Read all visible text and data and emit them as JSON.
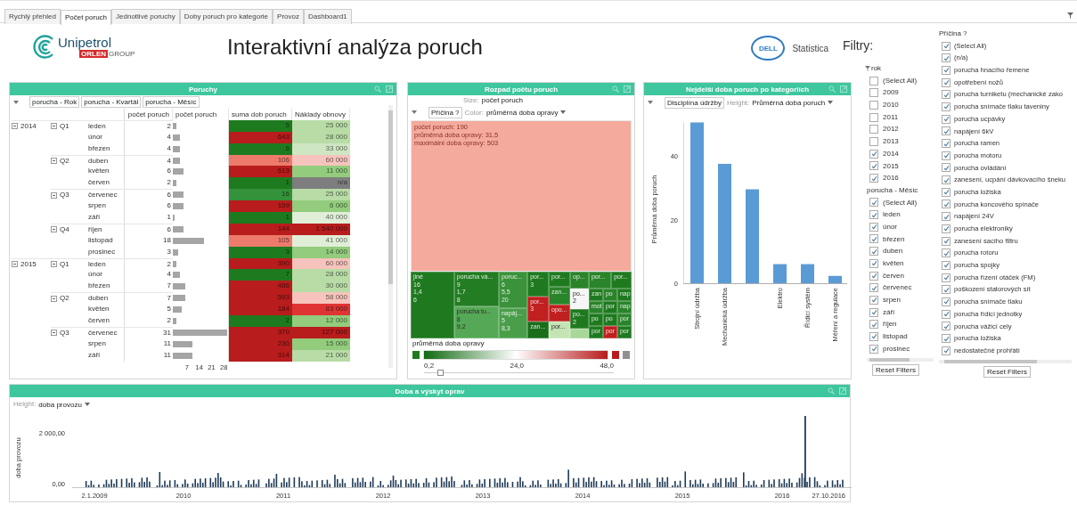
{
  "tabs": [
    {
      "label": "Rychlý přehled",
      "selected": false
    },
    {
      "label": "Počet poruch",
      "selected": true
    },
    {
      "label": "Jednotlivé poruchy",
      "selected": false
    },
    {
      "label": "Doby poruch pro kategorie",
      "selected": false
    },
    {
      "label": "Provoz",
      "selected": false
    },
    {
      "label": "Dashboard1",
      "selected": false
    }
  ],
  "header": {
    "logo_name": "Unipetrol",
    "logo_tag": "ORLEN",
    "logo_group": "GROUP",
    "title": "Interaktivní analýza poruch",
    "vendor_mark": "DELL",
    "vendor_product": "Statistica",
    "filters_title": "Filtry:"
  },
  "poruchy": {
    "title": "Poruchy",
    "fields": [
      "porucha - Rok",
      "porucha - Kvartál",
      "porucha - Měsíc"
    ],
    "columns": [
      "počet poruch",
      "počet poruch",
      "suma dob poruch",
      "Náklady obnovy"
    ],
    "bar_ticks": [
      "7",
      "14",
      "21",
      "28"
    ],
    "years": [
      {
        "label": "2014",
        "expanded": true,
        "children": [
          {
            "label": "Q1",
            "expanded": true,
            "children": [
              {
                "month": "leden",
                "count": "2",
                "suma": {
                  "text": "5",
                  "color": "#1e7a1e"
                },
                "naklady": {
                  "text": "25 000",
                  "color": "#b8dca6"
                }
              },
              {
                "month": "únor",
                "count": "4",
                "suma": {
                  "text": "643",
                  "color": "#b81c1c"
                },
                "naklady": {
                  "text": "28 000",
                  "color": "#b8dca6"
                }
              },
              {
                "month": "březen",
                "count": "4",
                "suma": {
                  "text": "6",
                  "color": "#1e7a1e"
                },
                "naklady": {
                  "text": "33 000",
                  "color": "#cfe6c2"
                }
              }
            ]
          },
          {
            "label": "Q2",
            "expanded": true,
            "children": [
              {
                "month": "duben",
                "count": "4",
                "suma": {
                  "text": "106",
                  "color": "#ee7a6c"
                },
                "naklady": {
                  "text": "60 000",
                  "color": "#f6c4bc"
                }
              },
              {
                "month": "květen",
                "count": "6",
                "suma": {
                  "text": "613",
                  "color": "#b81c1c"
                },
                "naklady": {
                  "text": "11 000",
                  "color": "#92cc7c"
                }
              },
              {
                "month": "červen",
                "count": "2",
                "suma": {
                  "text": "1",
                  "color": "#1e7a1e"
                },
                "naklady": {
                  "text": "n/a",
                  "color": "#7e7e7e"
                }
              }
            ]
          },
          {
            "label": "Q3",
            "expanded": true,
            "children": [
              {
                "month": "červenec",
                "count": "6",
                "suma": {
                  "text": "16",
                  "color": "#34923a"
                },
                "naklady": {
                  "text": "25 000",
                  "color": "#b8dca6"
                }
              },
              {
                "month": "srpen",
                "count": "6",
                "suma": {
                  "text": "159",
                  "color": "#b81c1c"
                },
                "naklady": {
                  "text": "6 000",
                  "color": "#92cc7c"
                }
              },
              {
                "month": "září",
                "count": "1",
                "suma": {
                  "text": "1",
                  "color": "#1e7a1e"
                },
                "naklady": {
                  "text": "40 000",
                  "color": "#e0eed8"
                }
              }
            ]
          },
          {
            "label": "Q4",
            "expanded": true,
            "children": [
              {
                "month": "říjen",
                "count": "6",
                "suma": {
                  "text": "144",
                  "color": "#b81c1c"
                },
                "naklady": {
                  "text": "1 540 000",
                  "color": "#b81c1c"
                }
              },
              {
                "month": "listopad",
                "count": "18",
                "suma": {
                  "text": "105",
                  "color": "#ee7a6c"
                },
                "naklady": {
                  "text": "41 000",
                  "color": "#e0eed8"
                }
              },
              {
                "month": "prosinec",
                "count": "3",
                "suma": {
                  "text": "3",
                  "color": "#1e7a1e"
                },
                "naklady": {
                  "text": "14 000",
                  "color": "#92cc7c"
                }
              }
            ]
          }
        ]
      },
      {
        "label": "2015",
        "expanded": true,
        "children": [
          {
            "label": "Q1",
            "expanded": true,
            "children": [
              {
                "month": "leden",
                "count": "2",
                "suma": {
                  "text": "390",
                  "color": "#b81c1c"
                },
                "naklady": {
                  "text": "60 000",
                  "color": "#f6c4bc"
                }
              },
              {
                "month": "únor",
                "count": "4",
                "suma": {
                  "text": "7",
                  "color": "#1e7a1e"
                },
                "naklady": {
                  "text": "28 000",
                  "color": "#b8dca6"
                }
              },
              {
                "month": "březen",
                "count": "7",
                "suma": {
                  "text": "486",
                  "color": "#b81c1c"
                },
                "naklady": {
                  "text": "30 000",
                  "color": "#b8dca6"
                }
              }
            ]
          },
          {
            "label": "Q2",
            "expanded": true,
            "children": [
              {
                "month": "duben",
                "count": "7",
                "suma": {
                  "text": "593",
                  "color": "#b81c1c"
                },
                "naklady": {
                  "text": "58 000",
                  "color": "#f6c4bc"
                }
              },
              {
                "month": "květen",
                "count": "5",
                "suma": {
                  "text": "184",
                  "color": "#b81c1c"
                },
                "naklady": {
                  "text": "83 000",
                  "color": "#e03434"
                }
              },
              {
                "month": "červen",
                "count": "2",
                "suma": {
                  "text": "2",
                  "color": "#1e7a1e"
                },
                "naklady": {
                  "text": "12 000",
                  "color": "#92cc7c"
                }
              }
            ]
          },
          {
            "label": "Q3",
            "expanded": true,
            "children": [
              {
                "month": "červenec",
                "count": "31",
                "suma": {
                  "text": "370",
                  "color": "#b81c1c"
                },
                "naklady": {
                  "text": "127 000",
                  "color": "#b81c1c"
                }
              },
              {
                "month": "srpen",
                "count": "11",
                "suma": {
                  "text": "230",
                  "color": "#b81c1c"
                },
                "naklady": {
                  "text": "15 000",
                  "color": "#92cc7c"
                }
              },
              {
                "month": "září",
                "count": "11",
                "suma": {
                  "text": "314",
                  "color": "#b81c1c"
                },
                "naklady": {
                  "text": "21 000",
                  "color": "#b8dca6"
                }
              }
            ]
          }
        ]
      }
    ]
  },
  "treemap": {
    "title": "Rozpad počtu poruch",
    "size_label": "Size:",
    "size_value": "počet poruch",
    "field": "Příčina ?",
    "color_label": "Color:",
    "color_value": "průměrná doba opravy",
    "main_tile": {
      "color": "#f4aa9c",
      "lines": [
        "počet poruch: 190",
        "průměrná doba opravy: 31,5",
        "maximální doba opravy: 503"
      ]
    },
    "tiles": [
      {
        "color": "#1f7a1f",
        "lines": [
          "jiné",
          "16",
          "1,4",
          "6"
        ]
      },
      {
        "color": "#237d23",
        "lines": [
          "porucha vá...",
          "9",
          "1,7",
          "8"
        ]
      },
      {
        "color": "#55a855",
        "lines": [
          "porucha tu...",
          "8",
          "9,2"
        ]
      },
      {
        "color": "#3a923a",
        "lines": [
          "poruc...",
          "6",
          "5,5",
          "20"
        ]
      },
      {
        "color": "#4a9e4a",
        "lines": [
          "napáj...",
          "5",
          "8,3"
        ]
      },
      {
        "color": "#1f7a1f",
        "lines": [
          "por...",
          "3"
        ]
      },
      {
        "color": "#c02020",
        "lines": [
          "por...",
          "3"
        ]
      },
      {
        "color": "#1a6e1a",
        "lines": [
          "zan..."
        ]
      },
      {
        "color": "#1f7a1f",
        "lines": [
          "por..."
        ]
      },
      {
        "color": "#2a842a",
        "lines": [
          "zan..."
        ]
      },
      {
        "color": "#c02020",
        "lines": [
          "opo..."
        ]
      },
      {
        "color": "#c4e4b4",
        "lines": [
          "por..."
        ]
      },
      {
        "color": "#2a842a",
        "lines": [
          "op..."
        ]
      },
      {
        "color": "#f6f6f6",
        "lines": [
          "po...",
          "2"
        ]
      },
      {
        "color": "#1f7a1f",
        "lines": [
          "po...",
          "2"
        ]
      },
      {
        "color": "#a8d898"
      },
      {
        "color": "#2a842a",
        "lines": [
          "por..."
        ]
      },
      {
        "color": "#1f7a1f",
        "lines": [
          "por..."
        ]
      },
      {
        "color": "#1f7a1f",
        "lines": [
          "zan"
        ]
      },
      {
        "color": "#2a842a",
        "lines": [
          "po"
        ]
      },
      {
        "color": "#1f7a1f",
        "lines": [
          "nap"
        ]
      },
      {
        "color": "#2a842a",
        "lines": [
          "mot"
        ]
      },
      {
        "color": "#1f7a1f",
        "lines": [
          "por"
        ]
      },
      {
        "color": "#2a842a",
        "lines": [
          "nap"
        ]
      },
      {
        "color": "#1f7a1f",
        "lines": [
          "po"
        ]
      },
      {
        "color": "#1f7a1f",
        "lines": [
          "po"
        ]
      },
      {
        "color": "#2a842a",
        "lines": [
          "por"
        ]
      },
      {
        "color": "#1f7a1f",
        "lines": [
          "por"
        ]
      },
      {
        "color": "#c02020",
        "lines": [
          "por"
        ]
      },
      {
        "color": "#1f7a1f",
        "lines": [
          "por"
        ]
      }
    ],
    "legend": {
      "title": "průměrná doba opravy",
      "labels": [
        "0,2",
        "24,0",
        "48,0"
      ],
      "level": 0.07
    }
  },
  "categories_chart": {
    "title": "Nejdelší doba poruch po kategoriích",
    "field": "Disciplína údržby",
    "height_label": "Height:",
    "height_value": "Průměrná doba poruch",
    "chart_data": {
      "type": "bar",
      "ylabel": "Průměrná doba poruch",
      "categories": [
        "Strojní údržba",
        "Mechanická údržba",
        null,
        "Elektro",
        "Řídicí systém",
        "Měření a regulace"
      ],
      "values": [
        50.5,
        37.5,
        29.5,
        6,
        6,
        2.3
      ],
      "yticks": [
        0,
        20,
        40
      ],
      "ylim": [
        0,
        50.5
      ]
    }
  },
  "operations": {
    "title": "Doba a výskyt oprav",
    "height_label": "Height:",
    "height_value": "doba provozu",
    "ylabel": "doba provozu",
    "yticks": [
      "2 000,00",
      "0,00"
    ],
    "xlabels": [
      "2.1.2009",
      "2010",
      "2011",
      "2012",
      "2013",
      "2014",
      "2015",
      "2016",
      "27.10.2016"
    ]
  },
  "filters": {
    "rok": {
      "label": "rok",
      "items": [
        {
          "label": "(Select All)",
          "checked": false
        },
        {
          "label": "2009",
          "checked": false
        },
        {
          "label": "2010",
          "checked": false
        },
        {
          "label": "2011",
          "checked": false
        },
        {
          "label": "2012",
          "checked": false
        },
        {
          "label": "2013",
          "checked": false
        },
        {
          "label": "2014",
          "checked": true
        },
        {
          "label": "2015",
          "checked": true
        },
        {
          "label": "2016",
          "checked": true
        }
      ]
    },
    "mesic": {
      "label": "porucha - Měsíc",
      "items": [
        {
          "label": "(Select All)",
          "checked": true
        },
        {
          "label": "leden",
          "checked": true
        },
        {
          "label": "únor",
          "checked": true
        },
        {
          "label": "březen",
          "checked": true
        },
        {
          "label": "duben",
          "checked": true
        },
        {
          "label": "květen",
          "checked": true
        },
        {
          "label": "červen",
          "checked": true
        },
        {
          "label": "červenec",
          "checked": true
        },
        {
          "label": "srpen",
          "checked": true
        },
        {
          "label": "září",
          "checked": true
        },
        {
          "label": "říjen",
          "checked": true
        },
        {
          "label": "listopad",
          "checked": true
        },
        {
          "label": "prosinec",
          "checked": true
        }
      ]
    },
    "pricina": {
      "label": "Příčina ?",
      "items": [
        {
          "label": "(Select All)",
          "checked": true
        },
        {
          "label": "(n/a)",
          "checked": true
        },
        {
          "label": "porucha hnacího řemene",
          "checked": true
        },
        {
          "label": "opotřebení nožů",
          "checked": true
        },
        {
          "label": "porucha turniketu (mechanické zako",
          "checked": true
        },
        {
          "label": "porucha snímače tlaku taveniny",
          "checked": true
        },
        {
          "label": "porucha ucpávky",
          "checked": true
        },
        {
          "label": "napájení 6kV",
          "checked": true
        },
        {
          "label": "porucha ramen",
          "checked": true
        },
        {
          "label": "porucha motoru",
          "checked": true
        },
        {
          "label": "porucha ovládání",
          "checked": true
        },
        {
          "label": "zanesení, ucpání dávkovacího šneku",
          "checked": true
        },
        {
          "label": "porucha ložiska",
          "checked": true
        },
        {
          "label": "porucha koncového spínače",
          "checked": true
        },
        {
          "label": "napájení 24V",
          "checked": true
        },
        {
          "label": "porucha elektroniky",
          "checked": true
        },
        {
          "label": "zanesení sacího filtru",
          "checked": true
        },
        {
          "label": "porucha rotoru",
          "checked": true
        },
        {
          "label": "porucha spojky",
          "checked": true
        },
        {
          "label": "porucha řízení otáček (FM)",
          "checked": true
        },
        {
          "label": "poškození statorových sít",
          "checked": true
        },
        {
          "label": "porucha snímače tlaku",
          "checked": true
        },
        {
          "label": "porucha řídicí jednotky",
          "checked": true
        },
        {
          "label": "porucha vážicí cely",
          "checked": true
        },
        {
          "label": "porucha ložiska",
          "checked": true
        },
        {
          "label": "nedostatečné prohřátí",
          "checked": true
        }
      ]
    },
    "reset_buttons": [
      "Reset Filters",
      "Reset Filters"
    ]
  }
}
